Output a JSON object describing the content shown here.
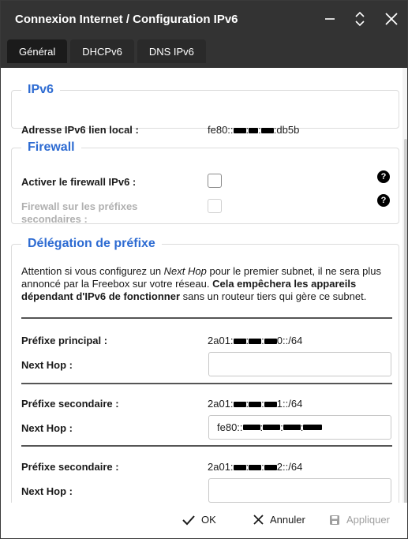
{
  "window": {
    "title": "Connexion Internet / Configuration IPv6",
    "controls": [
      "minimize-icon",
      "maximize-icon",
      "close-icon"
    ]
  },
  "tabs": [
    {
      "label": "Général",
      "active": true
    },
    {
      "label": "DHCPv6",
      "active": false
    },
    {
      "label": "DNS IPv6",
      "active": false
    }
  ],
  "ipv6": {
    "legend": "IPv6",
    "link_local_label": "Adresse IPv6 lien local :",
    "link_local_prefix": "fe80::",
    "link_local_suffix": ":db5b"
  },
  "firewall": {
    "legend": "Firewall",
    "enable_label": "Activer le firewall IPv6 :",
    "enable_checked": false,
    "secondary_label_line1": "Firewall sur les préfixes",
    "secondary_label_line2": "secondaires :",
    "secondary_checked": false,
    "secondary_disabled": true
  },
  "delegation": {
    "legend": "Délégation de préfixe",
    "note_part1": "Attention si vous configurez un ",
    "note_italic": "Next Hop",
    "note_part2": " pour le premier subnet, il ne sera plus annoncé par la Freebox sur votre réseau. ",
    "note_bold": "Cela empêchera les appareils dépendant d'IPv6 de fonctionner",
    "note_part3": " sans un routeur tiers qui gère ce subnet.",
    "prefixes": [
      {
        "label": "Préfixe principal :",
        "value_prefix": "2a01:",
        "value_suffix": "0::/64",
        "next_hop_label": "Next Hop :",
        "next_hop_value": ""
      },
      {
        "label": "Préfixe secondaire :",
        "value_prefix": "2a01:",
        "value_suffix": "1::/64",
        "next_hop_label": "Next Hop :",
        "next_hop_value": "fe80::"
      },
      {
        "label": "Préfixe secondaire :",
        "value_prefix": "2a01:",
        "value_suffix": "2::/64",
        "next_hop_label": "Next Hop :",
        "next_hop_value": ""
      }
    ]
  },
  "footer": {
    "ok_label": "OK",
    "cancel_label": "Annuler",
    "apply_label": "Appliquer"
  },
  "colors": {
    "accent": "#2d6bd2",
    "titlebar": "#333333",
    "tab_active": "#1b1b1b"
  }
}
